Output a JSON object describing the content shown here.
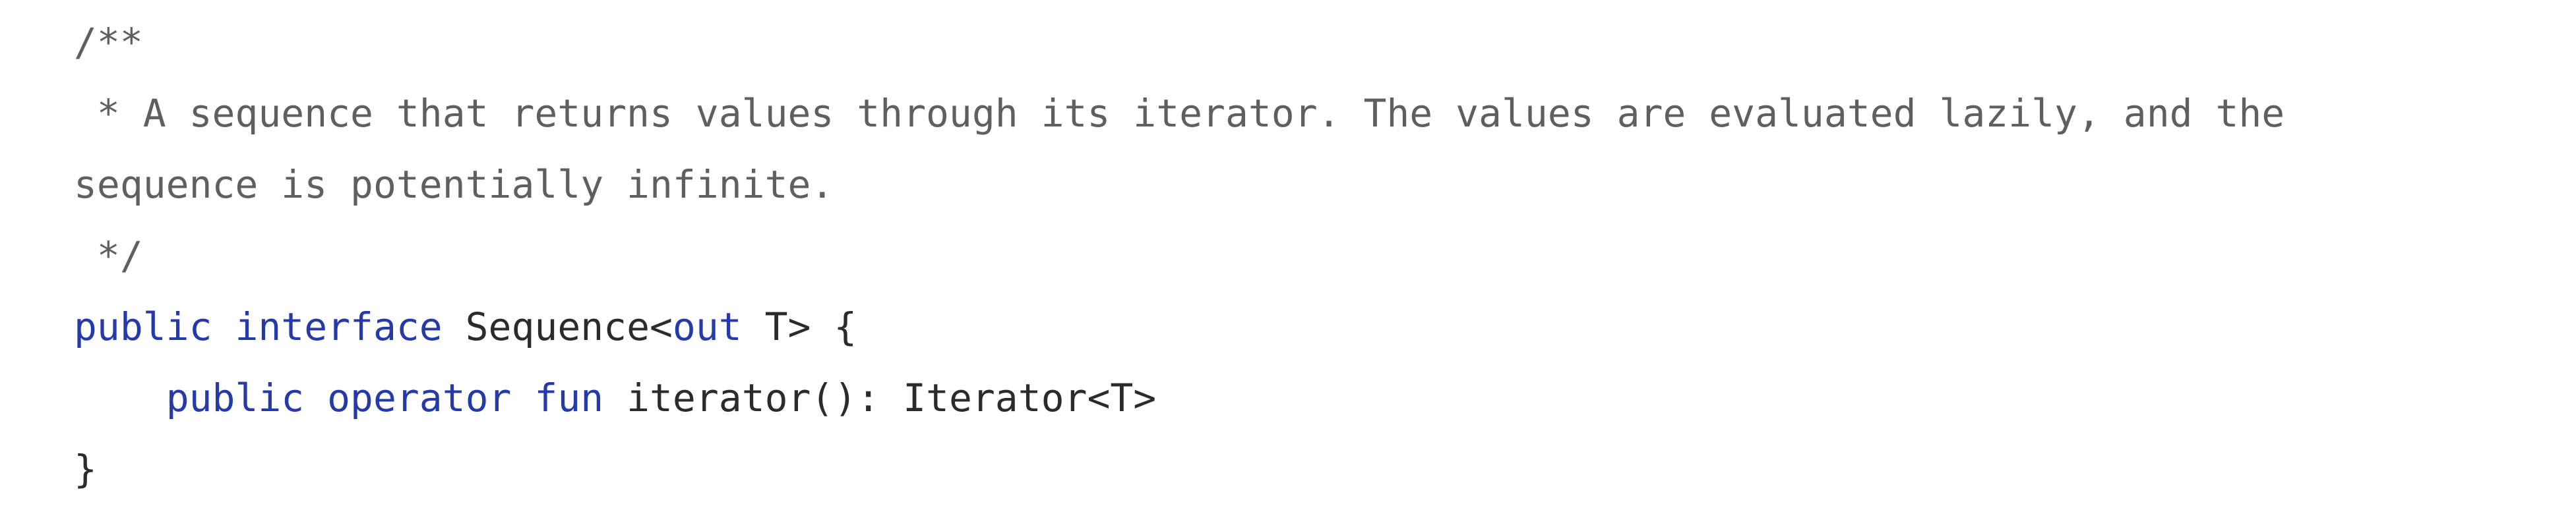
{
  "code": {
    "doc_comment": {
      "open": "/**",
      "line1": " * A sequence that returns values through its iterator. The values are evaluated lazily, and the",
      "line2": "sequence is potentially infinite.",
      "close": " */"
    },
    "declaration": {
      "kw_public": "public",
      "kw_interface": "interface",
      "type_name": "Sequence<",
      "kw_out": "out",
      "type_rest": " T> {"
    },
    "member": {
      "indent": "    ",
      "kw_public": "public",
      "kw_operator": "operator",
      "kw_fun": "fun",
      "signature": "iterator(): Iterator<T>"
    },
    "closing_brace": "}"
  },
  "colors": {
    "keyword": "#2639a8",
    "comment": "#5f5f5f",
    "text": "#2b2b2b",
    "background": "#ffffff"
  }
}
